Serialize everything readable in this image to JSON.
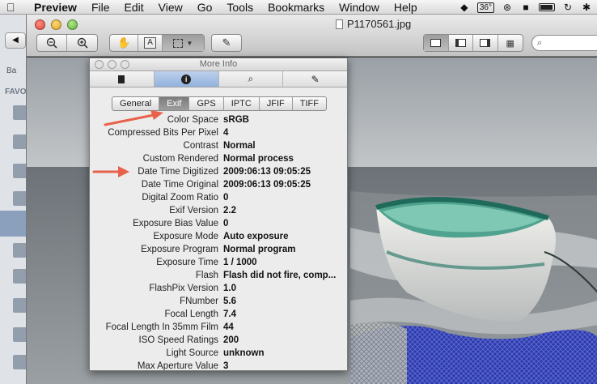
{
  "menubar": {
    "apple": "",
    "app_name": "Preview",
    "menus": [
      "File",
      "Edit",
      "View",
      "Go",
      "Tools",
      "Bookmarks",
      "Window",
      "Help"
    ],
    "temperature": "36°"
  },
  "finder": {
    "back_label": "Ba",
    "favorites_label": "FAVO"
  },
  "window": {
    "title": "P1170561.jpg",
    "toolbar": {
      "zoom_out": "−",
      "zoom_in": "+",
      "select_label": "A"
    }
  },
  "info_panel": {
    "title": "More Info",
    "top_tabs": [
      "general-icon",
      "info-icon",
      "search-icon",
      "pencil-icon"
    ],
    "active_top_tab": 1,
    "segments": [
      "General",
      "Exif",
      "GPS",
      "IPTC",
      "JFIF",
      "TIFF"
    ],
    "active_segment": "Exif",
    "properties": [
      {
        "key": "Color Space",
        "value": "sRGB"
      },
      {
        "key": "Compressed Bits Per Pixel",
        "value": "4"
      },
      {
        "key": "Contrast",
        "value": "Normal"
      },
      {
        "key": "Custom Rendered",
        "value": "Normal process"
      },
      {
        "key": "Date Time Digitized",
        "value": "2009:06:13 09:05:25"
      },
      {
        "key": "Date Time Original",
        "value": "2009:06:13 09:05:25"
      },
      {
        "key": "Digital Zoom Ratio",
        "value": "0"
      },
      {
        "key": "Exif Version",
        "value": "2.2"
      },
      {
        "key": "Exposure Bias Value",
        "value": "0"
      },
      {
        "key": "Exposure Mode",
        "value": "Auto exposure"
      },
      {
        "key": "Exposure Program",
        "value": "Normal program"
      },
      {
        "key": "Exposure Time",
        "value": "1 / 1000"
      },
      {
        "key": "Flash",
        "value": "Flash did not fire, comp..."
      },
      {
        "key": "FlashPix Version",
        "value": "1.0"
      },
      {
        "key": "FNumber",
        "value": "5.6"
      },
      {
        "key": "Focal Length",
        "value": "7.4"
      },
      {
        "key": "Focal Length In 35mm Film",
        "value": "44"
      },
      {
        "key": "ISO Speed Ratings",
        "value": "200"
      },
      {
        "key": "Light Source",
        "value": "unknown"
      },
      {
        "key": "Max Aperture Value",
        "value": "3"
      }
    ]
  },
  "colors": {
    "annotation_arrow": "#e8614a",
    "active_tab": "#92b2de"
  }
}
